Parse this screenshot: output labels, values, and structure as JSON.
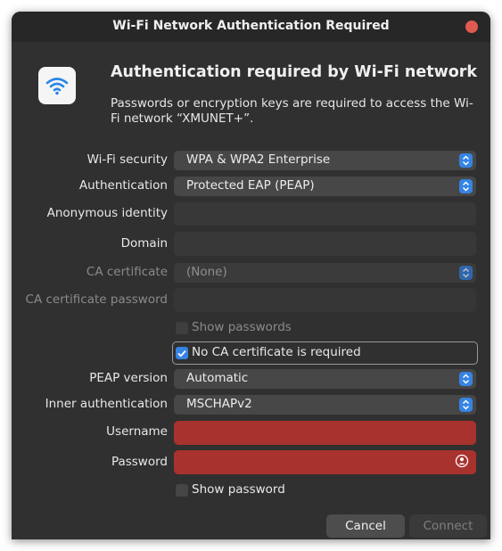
{
  "window": {
    "title": "Wi-Fi Network Authentication Required"
  },
  "header": {
    "icon": "wifi-icon",
    "heading": "Authentication required by Wi-Fi network",
    "description": "Passwords or encryption keys are required to access the Wi-Fi network “XMUNET+”."
  },
  "form": {
    "wifi_security": {
      "label": "Wi-Fi security",
      "value": "WPA & WPA2 Enterprise"
    },
    "authentication": {
      "label": "Authentication",
      "value": "Protected EAP (PEAP)"
    },
    "anonymous_identity": {
      "label": "Anonymous identity",
      "value": ""
    },
    "domain": {
      "label": "Domain",
      "value": ""
    },
    "ca_certificate": {
      "label": "CA certificate",
      "value": "(None)"
    },
    "ca_certificate_password": {
      "label": "CA certificate password",
      "value": ""
    },
    "show_passwords": {
      "label": "Show passwords",
      "checked": false
    },
    "no_ca_required": {
      "label": "No CA certificate is required",
      "checked": true
    },
    "peap_version": {
      "label": "PEAP version",
      "value": "Automatic"
    },
    "inner_authentication": {
      "label": "Inner authentication",
      "value": "MSCHAPv2"
    },
    "username": {
      "label": "Username",
      "value": ""
    },
    "password": {
      "label": "Password",
      "value": ""
    },
    "show_password": {
      "label": "Show password",
      "checked": false
    }
  },
  "buttons": {
    "cancel": "Cancel",
    "connect": "Connect"
  },
  "colors": {
    "accent": "#3584e4",
    "error_field": "#a8322d",
    "close": "#e05a51"
  }
}
